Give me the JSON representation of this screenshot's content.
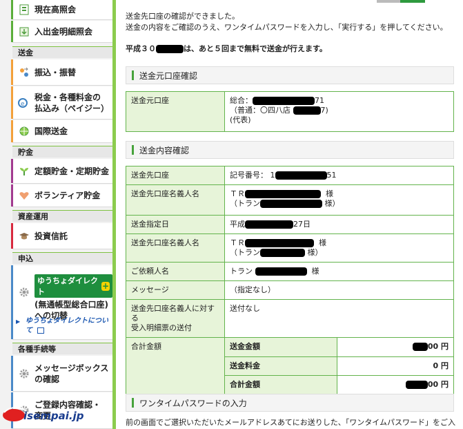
{
  "sidebar": {
    "top_items": [
      {
        "label": "現在高照会"
      },
      {
        "label": "入出金明細照会"
      }
    ],
    "sections": {
      "soukin": "送金",
      "chokin": "貯金",
      "shisan": "資産運用",
      "moushikomi": "申込",
      "tetsuzuki": "各種手続等"
    },
    "soukin_items": [
      "振込・振替",
      "税金・各種料金の",
      "払込み（ペイジー）",
      "国際送金"
    ],
    "chokin_items": [
      "定額貯金・定期貯金",
      "ボランティア貯金"
    ],
    "shisan_items": [
      "投資信託"
    ],
    "moushikomi": {
      "badge": "ゆうちょダイレクト",
      "line1": "(無通帳型総合口座)",
      "line2": "への切替",
      "link1": "ゆうちょダイレクトについ",
      "link2": "て"
    },
    "tetsuzuki_items": [
      "メッセージボックス",
      "の確認",
      "ご登録内容確認・",
      "変更"
    ]
  },
  "main": {
    "intro1": "送金先口座の確認ができました。",
    "intro2": "送金の内容をご確認のうえ、ワンタイムパスワードを入力し、「実行する」を押してください。",
    "notice_a": "平成３０",
    "notice_b": "は、あと５回まで無料で送金が行えます。",
    "sec1_title": "送金元口座確認",
    "sec1": {
      "h": "送金元口座",
      "l1a": "総合：",
      "l1b": "71",
      "l2a": "（普通：〇四八店",
      "l2b": "7)",
      "l3": "(代表)"
    },
    "sec2_title": "送金内容確認",
    "rows": {
      "r1h": "送金先口座",
      "r1a": "記号番号： 1",
      "r1b": "51",
      "r2h": "送金先口座名義人名",
      "r2a": "ＴＲ",
      "r2b": "様",
      "r2c": "（トラン",
      "r2d": "様）",
      "r3h": "送金指定日",
      "r3a": "平成",
      "r3b": "27日",
      "r4h": "送金先口座名義人名",
      "r4a": "ＴＲ",
      "r4b": "様",
      "r4c": "（トラン",
      "r4d": "様）",
      "r5h": "ご依頼人名",
      "r5a": "トラン",
      "r5b": "様",
      "r6h": "メッセージ",
      "r6a": "（指定なし）",
      "r7h1": "送金先口座名義人に対する",
      "r7h2": "受入明細票の送付",
      "r7a": "送付なし",
      "r8h": "合計金額",
      "sub1": "送金金額",
      "sub1v": "00 円",
      "sub2": "送金料金",
      "sub2v": "0 円",
      "sub3": "合計金額",
      "sub3v": "00 円"
    },
    "sec3_title": "ワンタイムパスワードの入力",
    "bottom": "前の画面でご選択いただいたメールアドレスあてにお送りした、「ワンタイムパスワード」をご入"
  },
  "watermark": "isempai.jp"
}
